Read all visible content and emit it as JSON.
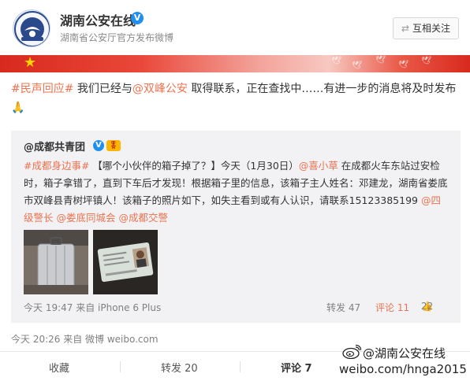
{
  "account": {
    "name": "湖南公安在线",
    "verified_mark": "V",
    "description": "湖南省公安厅官方发布微博",
    "follow_icon": "⇄",
    "follow_label": "互相关注"
  },
  "post": {
    "hashtag": "#民声回应#",
    "text_a": " 我们已经与",
    "mention": "@双峰公安",
    "text_b": " 取得联系，正在查找中……有进一步的消息将及时发布",
    "emoji": "🙏",
    "time": "今天 20:26 来自 微博 weibo.com"
  },
  "repost": {
    "user": "@成都共青团",
    "verified_mark": "V",
    "badge": "🎖",
    "hashtag": "#成都身边事#",
    "text_a": " 【哪个小伙伴的箱子掉了？】今天（1月30日）",
    "mention1": "@喜小草",
    "text_b": " 在成都火车东站过安检时，箱子拿错了，直到下车后才发现！根据箱子里的信息，该箱子主人姓名：邓建龙，湖南省娄底市双峰县青树坪镇人！该箱子的照片如下，如失主看到或有人认识，请联系15123385199 ",
    "mention2": "@四级警长",
    "mention3": "@娄底同城会",
    "mention4": "@成都交警",
    "time": "今天 19:47 来自 iPhone 6 Plus",
    "forward": "转发 47",
    "comment": "评论 11",
    "like_icon": "👍",
    "likes": "22"
  },
  "actions": {
    "collect": "收藏",
    "forward": "转发 20",
    "comment": "评论 7"
  },
  "watermark": {
    "line1": "@湖南公安在线",
    "line2": "weibo.com/hnga2015"
  }
}
